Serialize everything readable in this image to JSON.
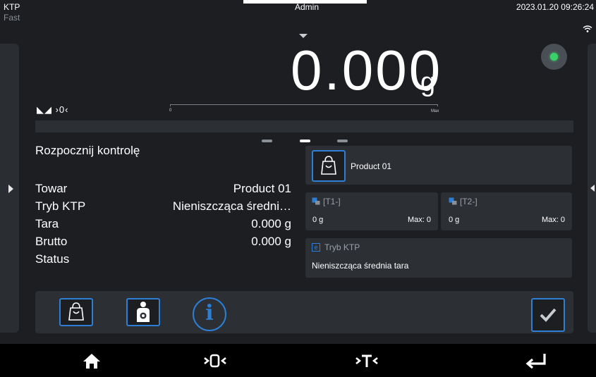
{
  "status_bar": {
    "mode": "KTP",
    "speed": "Fast",
    "user": "Admin",
    "datetime": "2023.01.20 09:26:24",
    "wifi_icon": "wifi-icon"
  },
  "weighing": {
    "value": "0.000",
    "unit": "g",
    "stability": "◣◢ ›0‹",
    "bargraph_min": "0",
    "bargraph_max": "Max",
    "bargraph_fill": 0,
    "led_color": "#3ad16b"
  },
  "info": {
    "title": "Rozpocznij kontrolę",
    "rows": [
      {
        "label": "Towar",
        "value": "Product 01"
      },
      {
        "label": "Tryb KTP",
        "value": "Nieniszcząca średni…"
      },
      {
        "label": "Tara",
        "value": "0.000 g"
      },
      {
        "label": "Brutto",
        "value": "0.000 g"
      },
      {
        "label": "Status",
        "value": ""
      }
    ]
  },
  "widgets": {
    "product": {
      "name": "Product 01",
      "icon": "shopping-bag-icon"
    },
    "t1": {
      "label": "[T1-]",
      "value": "0 g",
      "max": "Max: 0"
    },
    "t2": {
      "label": "[T2-]",
      "value": "0 g",
      "max": "Max: 0"
    },
    "mode": {
      "icon_letter": "e",
      "label": "Tryb KTP",
      "value": "Nieniszcząca średnia tara"
    }
  },
  "actions": {
    "icons": [
      "shopping-bag-icon",
      "operator-settings-icon",
      "info-icon",
      "checkmark-icon"
    ],
    "info_glyph": "i"
  },
  "navigation": {
    "icons": [
      "home-icon",
      "zero-icon",
      "tare-icon",
      "enter-icon"
    ]
  },
  "colors": {
    "accent": "#2d7fd6",
    "background": "#1c1e22",
    "panel": "#2c2f34",
    "stable_led": "#3ad16b"
  }
}
